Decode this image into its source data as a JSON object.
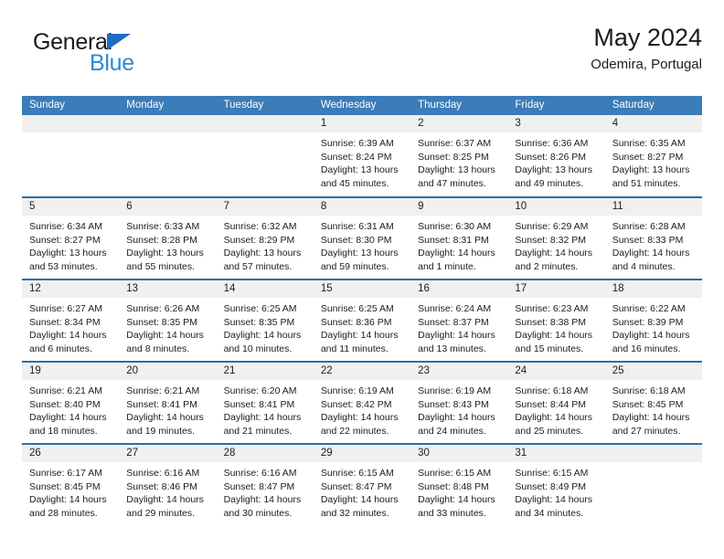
{
  "brand": {
    "word1": "General",
    "word2": "Blue",
    "triangle_color": "#1b6ec2",
    "blue_color": "#2b8ad6"
  },
  "header": {
    "title": "May 2024",
    "subtitle": "Odemira, Portugal"
  },
  "theme": {
    "header_band": "#3b7cb9",
    "row_divider": "#2e6da4",
    "daynum_band": "#f0f0f0"
  },
  "weekdays": [
    "Sunday",
    "Monday",
    "Tuesday",
    "Wednesday",
    "Thursday",
    "Friday",
    "Saturday"
  ],
  "weeks": [
    [
      {
        "day": "",
        "sunrise": "",
        "sunset": "",
        "daylight": ""
      },
      {
        "day": "",
        "sunrise": "",
        "sunset": "",
        "daylight": ""
      },
      {
        "day": "",
        "sunrise": "",
        "sunset": "",
        "daylight": ""
      },
      {
        "day": "1",
        "sunrise": "Sunrise: 6:39 AM",
        "sunset": "Sunset: 8:24 PM",
        "daylight": "Daylight: 13 hours and 45 minutes."
      },
      {
        "day": "2",
        "sunrise": "Sunrise: 6:37 AM",
        "sunset": "Sunset: 8:25 PM",
        "daylight": "Daylight: 13 hours and 47 minutes."
      },
      {
        "day": "3",
        "sunrise": "Sunrise: 6:36 AM",
        "sunset": "Sunset: 8:26 PM",
        "daylight": "Daylight: 13 hours and 49 minutes."
      },
      {
        "day": "4",
        "sunrise": "Sunrise: 6:35 AM",
        "sunset": "Sunset: 8:27 PM",
        "daylight": "Daylight: 13 hours and 51 minutes."
      }
    ],
    [
      {
        "day": "5",
        "sunrise": "Sunrise: 6:34 AM",
        "sunset": "Sunset: 8:27 PM",
        "daylight": "Daylight: 13 hours and 53 minutes."
      },
      {
        "day": "6",
        "sunrise": "Sunrise: 6:33 AM",
        "sunset": "Sunset: 8:28 PM",
        "daylight": "Daylight: 13 hours and 55 minutes."
      },
      {
        "day": "7",
        "sunrise": "Sunrise: 6:32 AM",
        "sunset": "Sunset: 8:29 PM",
        "daylight": "Daylight: 13 hours and 57 minutes."
      },
      {
        "day": "8",
        "sunrise": "Sunrise: 6:31 AM",
        "sunset": "Sunset: 8:30 PM",
        "daylight": "Daylight: 13 hours and 59 minutes."
      },
      {
        "day": "9",
        "sunrise": "Sunrise: 6:30 AM",
        "sunset": "Sunset: 8:31 PM",
        "daylight": "Daylight: 14 hours and 1 minute."
      },
      {
        "day": "10",
        "sunrise": "Sunrise: 6:29 AM",
        "sunset": "Sunset: 8:32 PM",
        "daylight": "Daylight: 14 hours and 2 minutes."
      },
      {
        "day": "11",
        "sunrise": "Sunrise: 6:28 AM",
        "sunset": "Sunset: 8:33 PM",
        "daylight": "Daylight: 14 hours and 4 minutes."
      }
    ],
    [
      {
        "day": "12",
        "sunrise": "Sunrise: 6:27 AM",
        "sunset": "Sunset: 8:34 PM",
        "daylight": "Daylight: 14 hours and 6 minutes."
      },
      {
        "day": "13",
        "sunrise": "Sunrise: 6:26 AM",
        "sunset": "Sunset: 8:35 PM",
        "daylight": "Daylight: 14 hours and 8 minutes."
      },
      {
        "day": "14",
        "sunrise": "Sunrise: 6:25 AM",
        "sunset": "Sunset: 8:35 PM",
        "daylight": "Daylight: 14 hours and 10 minutes."
      },
      {
        "day": "15",
        "sunrise": "Sunrise: 6:25 AM",
        "sunset": "Sunset: 8:36 PM",
        "daylight": "Daylight: 14 hours and 11 minutes."
      },
      {
        "day": "16",
        "sunrise": "Sunrise: 6:24 AM",
        "sunset": "Sunset: 8:37 PM",
        "daylight": "Daylight: 14 hours and 13 minutes."
      },
      {
        "day": "17",
        "sunrise": "Sunrise: 6:23 AM",
        "sunset": "Sunset: 8:38 PM",
        "daylight": "Daylight: 14 hours and 15 minutes."
      },
      {
        "day": "18",
        "sunrise": "Sunrise: 6:22 AM",
        "sunset": "Sunset: 8:39 PM",
        "daylight": "Daylight: 14 hours and 16 minutes."
      }
    ],
    [
      {
        "day": "19",
        "sunrise": "Sunrise: 6:21 AM",
        "sunset": "Sunset: 8:40 PM",
        "daylight": "Daylight: 14 hours and 18 minutes."
      },
      {
        "day": "20",
        "sunrise": "Sunrise: 6:21 AM",
        "sunset": "Sunset: 8:41 PM",
        "daylight": "Daylight: 14 hours and 19 minutes."
      },
      {
        "day": "21",
        "sunrise": "Sunrise: 6:20 AM",
        "sunset": "Sunset: 8:41 PM",
        "daylight": "Daylight: 14 hours and 21 minutes."
      },
      {
        "day": "22",
        "sunrise": "Sunrise: 6:19 AM",
        "sunset": "Sunset: 8:42 PM",
        "daylight": "Daylight: 14 hours and 22 minutes."
      },
      {
        "day": "23",
        "sunrise": "Sunrise: 6:19 AM",
        "sunset": "Sunset: 8:43 PM",
        "daylight": "Daylight: 14 hours and 24 minutes."
      },
      {
        "day": "24",
        "sunrise": "Sunrise: 6:18 AM",
        "sunset": "Sunset: 8:44 PM",
        "daylight": "Daylight: 14 hours and 25 minutes."
      },
      {
        "day": "25",
        "sunrise": "Sunrise: 6:18 AM",
        "sunset": "Sunset: 8:45 PM",
        "daylight": "Daylight: 14 hours and 27 minutes."
      }
    ],
    [
      {
        "day": "26",
        "sunrise": "Sunrise: 6:17 AM",
        "sunset": "Sunset: 8:45 PM",
        "daylight": "Daylight: 14 hours and 28 minutes."
      },
      {
        "day": "27",
        "sunrise": "Sunrise: 6:16 AM",
        "sunset": "Sunset: 8:46 PM",
        "daylight": "Daylight: 14 hours and 29 minutes."
      },
      {
        "day": "28",
        "sunrise": "Sunrise: 6:16 AM",
        "sunset": "Sunset: 8:47 PM",
        "daylight": "Daylight: 14 hours and 30 minutes."
      },
      {
        "day": "29",
        "sunrise": "Sunrise: 6:15 AM",
        "sunset": "Sunset: 8:47 PM",
        "daylight": "Daylight: 14 hours and 32 minutes."
      },
      {
        "day": "30",
        "sunrise": "Sunrise: 6:15 AM",
        "sunset": "Sunset: 8:48 PM",
        "daylight": "Daylight: 14 hours and 33 minutes."
      },
      {
        "day": "31",
        "sunrise": "Sunrise: 6:15 AM",
        "sunset": "Sunset: 8:49 PM",
        "daylight": "Daylight: 14 hours and 34 minutes."
      },
      {
        "day": "",
        "sunrise": "",
        "sunset": "",
        "daylight": ""
      }
    ]
  ]
}
